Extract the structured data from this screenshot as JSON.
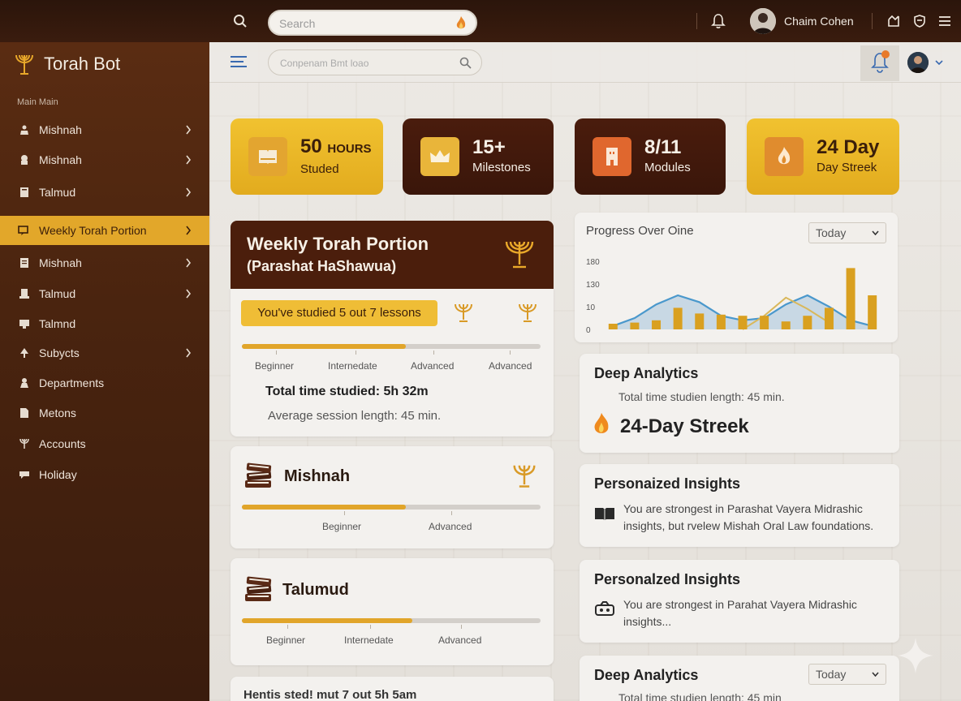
{
  "topbar": {
    "search_placeholder": "Search",
    "username": "Chaim Cohen"
  },
  "sidebar": {
    "brand": "Torah Bot",
    "section_label": "Main Main",
    "items": [
      {
        "label": "Mishnah",
        "has_chevron": true
      },
      {
        "label": "Mishnah",
        "has_chevron": true
      },
      {
        "label": "Talmud",
        "has_chevron": true
      },
      {
        "label": "Weekly Torah Portion",
        "has_chevron": true,
        "active": true
      },
      {
        "label": "Mishnah",
        "has_chevron": true
      },
      {
        "label": "Talmud",
        "has_chevron": true
      },
      {
        "label": "Talmnd",
        "has_chevron": false
      },
      {
        "label": "Subycts",
        "has_chevron": true
      },
      {
        "label": "Departments",
        "has_chevron": false
      },
      {
        "label": "Metons",
        "has_chevron": false
      },
      {
        "label": "Accounts",
        "has_chevron": false
      },
      {
        "label": "Holiday",
        "has_chevron": false
      }
    ]
  },
  "subheader": {
    "search_placeholder": "Conpenam Bmt loao",
    "notification_count": "1"
  },
  "stats": [
    {
      "value": "50",
      "unit": "HOURS",
      "label": "Studed"
    },
    {
      "value": "15+",
      "unit": "",
      "label": "Milestones"
    },
    {
      "value": "8/11",
      "unit": "",
      "label": "Modules"
    },
    {
      "value": "24 Day",
      "unit": "",
      "label": "Day Streek"
    }
  ],
  "weekly": {
    "title": "Weekly Torah Portion",
    "subtitle": "(Parashat HaShawua)",
    "lessons_pill": "You've studied 5 out 7 lessons",
    "progress": 0.55,
    "levels": [
      "Beginner",
      "Internedate",
      "Advanced",
      "Advanced"
    ],
    "total_time": "Total time studied: 5h 32m",
    "avg_session": "Average session length: 45 min."
  },
  "courses": [
    {
      "title": "Mishnah",
      "progress": 0.55,
      "levels": [
        "Beginner",
        "Advanced"
      ]
    },
    {
      "title": "Talumud",
      "progress": 0.57,
      "levels": [
        "Beginner",
        "Internedate",
        "Advanced"
      ]
    }
  ],
  "bottom_cut_text": "Hentis sted! mut 7 out 5h 5am",
  "chart": {
    "title": "Progress Over Oine",
    "period": "Today"
  },
  "chart_data": {
    "type": "bar",
    "y_ticks": [
      "180",
      "130",
      "10",
      "0"
    ],
    "values": [
      5,
      6,
      8,
      19,
      14,
      13,
      12,
      12,
      7,
      12,
      19,
      54,
      30
    ],
    "line_values": [
      3,
      10,
      22,
      30,
      24,
      12,
      8,
      10,
      22,
      30,
      20,
      8,
      3
    ],
    "accent_line_values": [
      0,
      0,
      0,
      0,
      0,
      0,
      0,
      12,
      28,
      18,
      6,
      0,
      0
    ]
  },
  "deep_analytics": {
    "title": "Deep Analytics",
    "line": "Total time studien length: 45 min.",
    "streak": "24-Day Streek"
  },
  "insights1": {
    "title": "Personaized Insights",
    "text": "You are strongest in Parashat Vayera Midrashic insights, but rvelew Mishah Oral Law foundations."
  },
  "insights2": {
    "title": "Personalzed Insights",
    "text": "You are strongest in Parahat Vayera Midrashic insights..."
  },
  "deep_analytics2": {
    "title": "Deep Analytics",
    "period": "Today",
    "line": "Total time studien length: 45 min"
  },
  "colors": {
    "gold": "#e2a72a",
    "brown": "#4b1e0c",
    "sidebar": "#4a240f"
  }
}
